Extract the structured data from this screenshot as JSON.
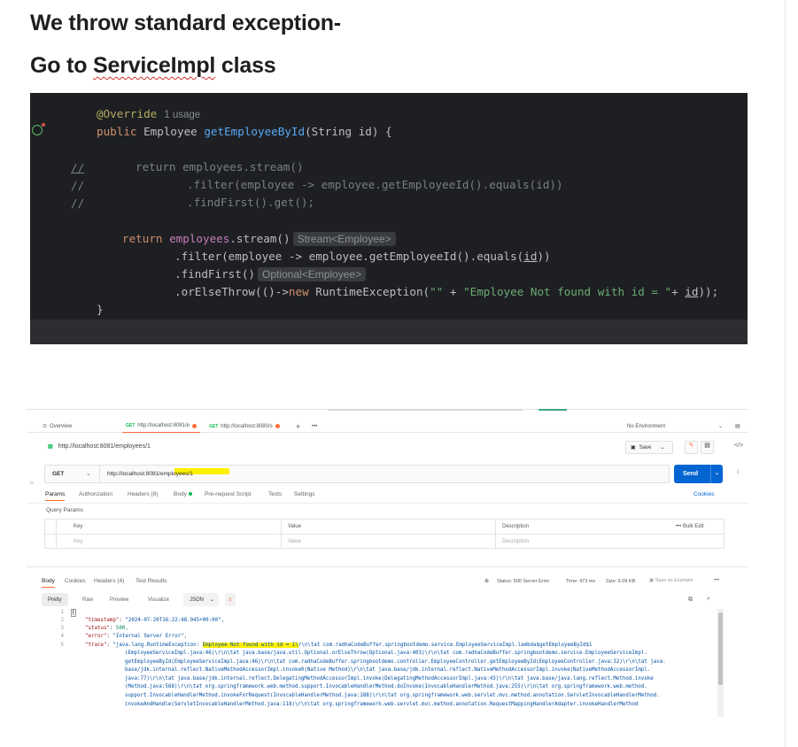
{
  "headings": {
    "line1": "We throw standard exception-",
    "line2_prefix": "Go to ",
    "line2_word": "ServiceImpl",
    "line2_suffix": " class"
  },
  "code": {
    "annotation": "@Override",
    "usage_hint": "1 usage",
    "sig_public": "public",
    "sig_type": " Employee ",
    "sig_method": "getEmployeeById",
    "sig_params": "(String id) {",
    "comment_marker": "//",
    "comment1": "return employees.stream()",
    "comment2": ".filter(employee -> employee.getEmployeeId().equals(id))",
    "comment3": ".findFirst().get();",
    "ret_kw": "return ",
    "ret_field": "employees",
    "ret_call": ".stream()",
    "hint_stream": "Stream<Employee>",
    "filter_line_a": ".filter(employee -> employee.getEmployeeId().equals(",
    "filter_line_param": "id",
    "filter_line_b": "))",
    "findfirst": ".findFirst()",
    "hint_optional": "Optional<Employee>",
    "orelse_a": ".orElseThrow(()->",
    "orelse_new": "new",
    "orelse_b": " RuntimeException(",
    "orelse_str1": "\"\"",
    "orelse_plus": " + ",
    "orelse_str2": "\"Employee Not found with id = \"",
    "orelse_c": "+ ",
    "orelse_param": "id",
    "orelse_d": "));",
    "close_brace": "}"
  },
  "postman": {
    "tabs": {
      "overview": "Overview",
      "tab1_method": "GET",
      "tab1_url": "http://localhost:8081/e",
      "tab2_method": "GET",
      "tab2_url": "http://localhost:8080/s",
      "plus": "+",
      "more": "•••",
      "environment": "No Environment"
    },
    "request": {
      "title_url": "http://localhost:8081/employees/1",
      "save_label": "Save",
      "method": "GET",
      "url": "http://localhost:8081/employees/1",
      "send_label": "Send"
    },
    "request_tabs": {
      "params": "Params",
      "authorization": "Authorization",
      "headers": "Headers (8)",
      "body": "Body",
      "prerequest": "Pre-request Script",
      "tests": "Tests",
      "settings": "Settings",
      "cookies": "Cookies"
    },
    "query_params": {
      "title": "Query Params",
      "col_key": "Key",
      "col_value": "Value",
      "col_description": "Description",
      "bulk_edit": "Bulk Edit",
      "ph_key": "Key",
      "ph_value": "Value",
      "ph_description": "Description"
    },
    "response_tabs": {
      "body": "Body",
      "cookies": "Cookies",
      "headers": "Headers (4)",
      "test_results": "Test Results",
      "status": "Status: 500 Server Error",
      "time": "Time: 473 ms",
      "size": "Size: 6.09 KB",
      "save_example": "Save as Example",
      "more": "•••"
    },
    "format_bar": {
      "pretty": "Pretty",
      "raw": "Raw",
      "preview": "Preview",
      "visualize": "Visualize",
      "format": "JSON"
    },
    "json": {
      "line_numbers": [
        "1",
        "2",
        "3",
        "4",
        "5"
      ],
      "open_brace": "{",
      "k_timestamp": "\"timestamp\"",
      "v_timestamp": "\"2024-07-20T16:22:48.945+00:00\",",
      "k_status": "\"status\"",
      "v_status": "500,",
      "k_error": "\"error\"",
      "v_error": "\"Internal Server Error\",",
      "k_trace": "\"trace\"",
      "trace_a": "\"java.lang.RuntimeException: ",
      "trace_hl": "Employee Not found with id = 1\\",
      "trace_b": "r\\n\\tat com.radhaCodeBuffer.springbootdemo.service.EmployeeServiceImpl.lambda$getEmployeeById$1",
      "trace_c": "(EmployeeServiceImpl.java:46)\\r\\n\\tat java.base/java.util.Optional.orElseThrow(Optional.java:403)\\r\\n\\tat com.radhaCodeBuffer.springbootdemo.service.EmployeeServiceImpl.",
      "trace_d": "getEmployeeById(EmployeeServiceImpl.java:46)\\r\\n\\tat com.radhaCodeBuffer.springbootdemo.controller.EmployeeController.getEmployeeById(EmployeeController.java:32)\\r\\n\\tat java.",
      "trace_e": "base/jdk.internal.reflect.NativeMethodAccessorImpl.invoke0(Native Method)\\r\\n\\tat java.base/jdk.internal.reflect.NativeMethodAccessorImpl.invoke(NativeMethodAccessorImpl.",
      "trace_f": "java:77)\\r\\n\\tat java.base/jdk.internal.reflect.DelegatingMethodAccessorImpl.invoke(DelegatingMethodAccessorImpl.java:43)\\r\\n\\tat java.base/java.lang.reflect.Method.invoke",
      "trace_g": "(Method.java:568)\\r\\n\\tat org.springframework.web.method.support.InvocableHandlerMethod.doInvoke(InvocableHandlerMethod.java:255)\\r\\n\\tat org.springframework.web.method.",
      "trace_h": "support.InvocableHandlerMethod.invokeForRequest(InvocableHandlerMethod.java:188)\\r\\n\\tat org.springframework.web.servlet.mvc.method.annotation.ServletInvocableHandlerMethod.",
      "trace_i": "invokeAndHandle(ServletInvocableHandlerMethod.java:118)\\r\\n\\tat org.springframework.web.servlet.mvc.method.annotation.RequestMappingHandlerAdapter.invokeHandlerMethod"
    }
  },
  "colors": {
    "ide_bg": "#1e1f22",
    "postman_accent": "#ff6c37",
    "send_button": "#0265d2",
    "highlight": "#fff000"
  }
}
